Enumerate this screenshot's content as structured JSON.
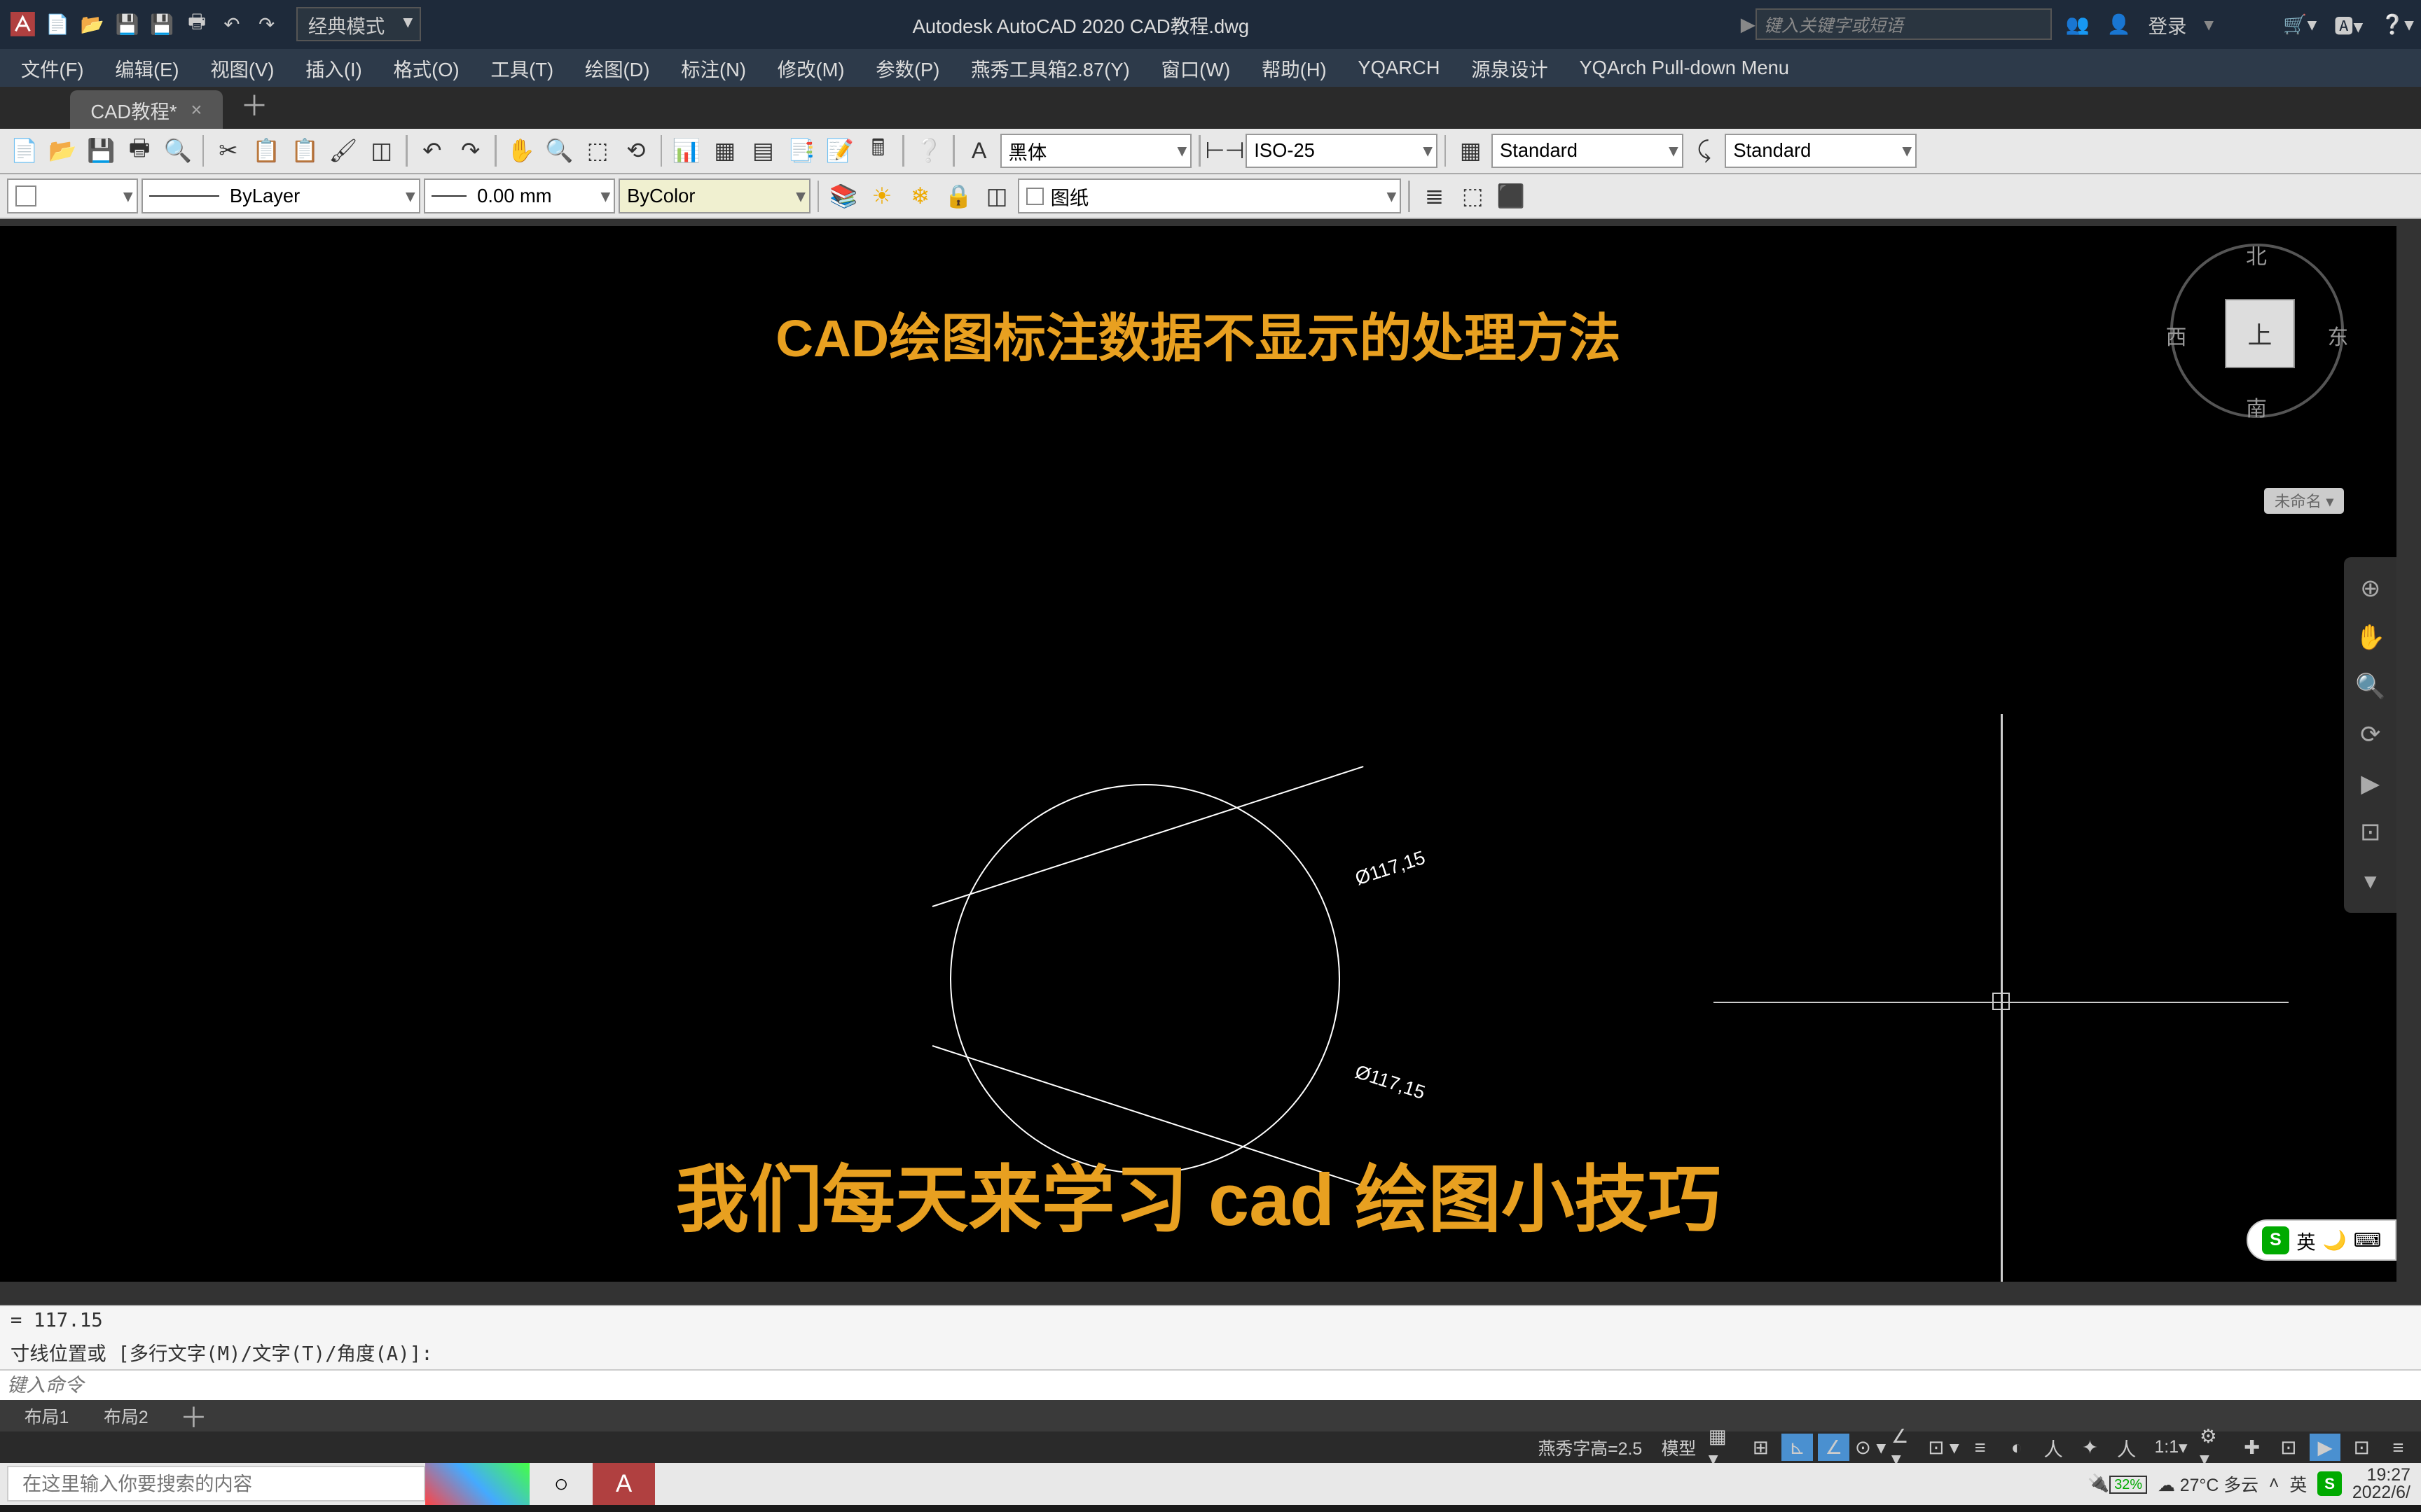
{
  "titlebar": {
    "workspace": "经典模式",
    "app_title": "Autodesk AutoCAD 2020   CAD教程.dwg",
    "search_placeholder": "键入关键字或短语",
    "login": "登录"
  },
  "menubar": {
    "items": [
      "文件(F)",
      "编辑(E)",
      "视图(V)",
      "插入(I)",
      "格式(O)",
      "工具(T)",
      "绘图(D)",
      "标注(N)",
      "修改(M)",
      "参数(P)",
      "燕秀工具箱2.87(Y)",
      "窗口(W)",
      "帮助(H)",
      "YQARCH",
      "源泉设计",
      "YQArch Pull-down Menu"
    ]
  },
  "filetabs": {
    "active": "CAD教程*"
  },
  "toolbar": {
    "font": "黑体",
    "dimstyle": "ISO-25",
    "textstyle": "Standard",
    "tablestyle": "Standard",
    "layer": "ByLayer",
    "lineweight": "0.00 mm",
    "color": "ByColor",
    "sheet": "图纸"
  },
  "canvas": {
    "title": "CAD绘图标注数据不显示的处理方法",
    "subtitle": "我们每天来学习 cad 绘图小技巧",
    "dim1": "Ø117,15",
    "dim2": "Ø117,15"
  },
  "viewcube": {
    "top": "上",
    "north": "北",
    "south": "南",
    "east": "东",
    "west": "西",
    "tag": "未命名"
  },
  "ime": {
    "mode": "英"
  },
  "cmd": {
    "hist1": "= 117.15",
    "hist2": "寸线位置或 [多行文字(M)/文字(T)/角度(A)]:",
    "input_placeholder": "键入命令"
  },
  "layout_tabs": {
    "t1": "布局1",
    "t2": "布局2"
  },
  "statusbar": {
    "yanxiu": "燕秀字高=2.5",
    "model": "模型",
    "scale": "1:1"
  },
  "taskbar": {
    "search_placeholder": "在这里输入你要搜索的内容",
    "weather": "27°C 多云",
    "ime_lang": "英",
    "battery": "32%",
    "time": "19:27",
    "date": "2022/6/"
  }
}
